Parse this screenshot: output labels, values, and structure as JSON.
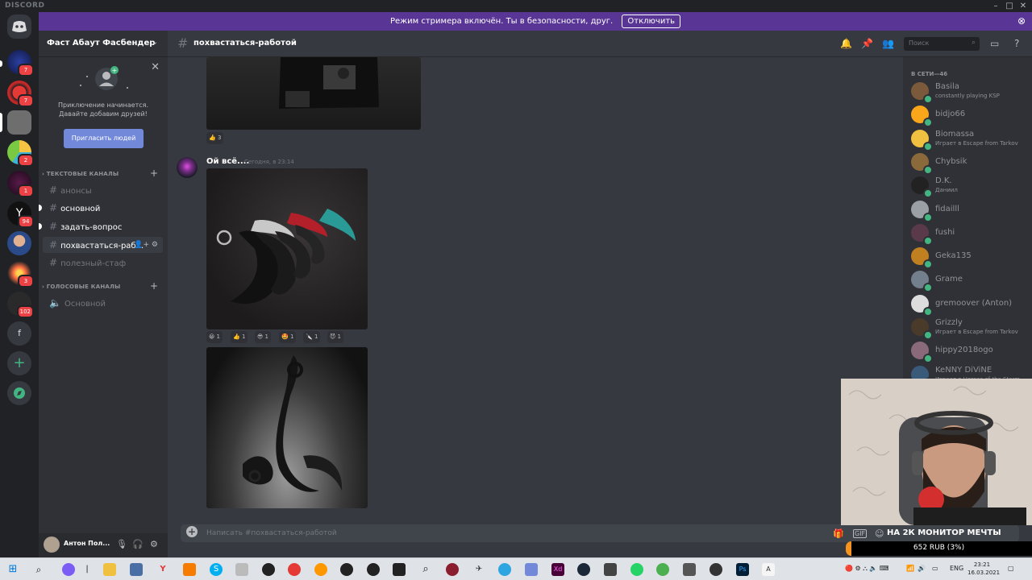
{
  "app": {
    "title": "DISCORD"
  },
  "banner": {
    "text": "Режим стримера включён. Ты в безопасности, друг.",
    "button": "Отключить"
  },
  "rail": {
    "badges": [
      "7",
      "7",
      "2",
      "1",
      "94",
      "3",
      "102"
    ],
    "facebook_glyph": "f",
    "add_glyph": "+"
  },
  "server": {
    "name": "Фаст Абаут Фасбендер"
  },
  "invite": {
    "line1": "Приключение начинается.",
    "line2": "Давайте добавим друзей!",
    "button": "Пригласить людей"
  },
  "categories": {
    "text": "ТЕКСТОВЫЕ КАНАЛЫ",
    "voice": "ГОЛОСОВЫЕ КАНАЛЫ"
  },
  "text_channels": [
    "анонсы",
    "основной",
    "задать-вопрос",
    "похвастаться-раб...",
    "полезный-стаф"
  ],
  "voice_channels": [
    "Основной"
  ],
  "user": {
    "name": "Антон Пол..."
  },
  "chat": {
    "channel_name": "похвастаться-работой",
    "search_placeholder": "Поиск",
    "composer_placeholder": "Написать #похвастаться-работой"
  },
  "messages": [
    {
      "reactions": [
        {
          "emoji": "👍",
          "count": "3"
        }
      ]
    },
    {
      "author": "Ой всё....",
      "timestamp": "Сегодня, в 23:14",
      "reactions": [
        {
          "emoji": "😀",
          "count": "1"
        },
        {
          "emoji": "👍",
          "count": "1"
        },
        {
          "emoji": "😎",
          "count": "1"
        },
        {
          "emoji": "🤩",
          "count": "1"
        },
        {
          "emoji": "🔪",
          "count": "1"
        },
        {
          "emoji": "😈",
          "count": "1"
        }
      ]
    }
  ],
  "members": {
    "header": "В СЕТИ—46",
    "list": [
      {
        "name": "Basila",
        "activity": "constantly playing KSP",
        "color": "#7a5a3a"
      },
      {
        "name": "bidjo66",
        "activity": "",
        "color": "#faa61a"
      },
      {
        "name": "Biomassa",
        "activity": "Играет в Escape from Tarkov",
        "color": "#f0c040"
      },
      {
        "name": "Chybsik",
        "activity": "",
        "color": "#8a6a3a"
      },
      {
        "name": "D.K.",
        "activity": "Даниил",
        "color": "#222222"
      },
      {
        "name": "fidailll",
        "activity": "",
        "color": "#9aa0a6"
      },
      {
        "name": "fushi",
        "activity": "",
        "color": "#5a3a4a"
      },
      {
        "name": "Geka135",
        "activity": "",
        "color": "#c08020"
      },
      {
        "name": "Grame",
        "activity": "",
        "color": "#747f8d"
      },
      {
        "name": "gremoover (Anton)",
        "activity": "",
        "color": "#dddddd"
      },
      {
        "name": "Grizzly",
        "activity": "Играет в Escape from Tarkov",
        "color": "#4a3a2a"
      },
      {
        "name": "hippy2018ogo",
        "activity": "",
        "color": "#8a6a7a"
      },
      {
        "name": "KeNNY DiViNE",
        "activity": "Играет в Heroes of the Storm",
        "color": "#3a5a7a"
      }
    ]
  },
  "stream": {
    "overlay_title": "НА 2К МОНИТОР МЕЧТЫ",
    "donation": "652 RUB (3%)",
    "donation_progress": 0.03
  },
  "taskbar": {
    "lang": "ENG",
    "time": "23:21",
    "date": "16.03.2021"
  }
}
